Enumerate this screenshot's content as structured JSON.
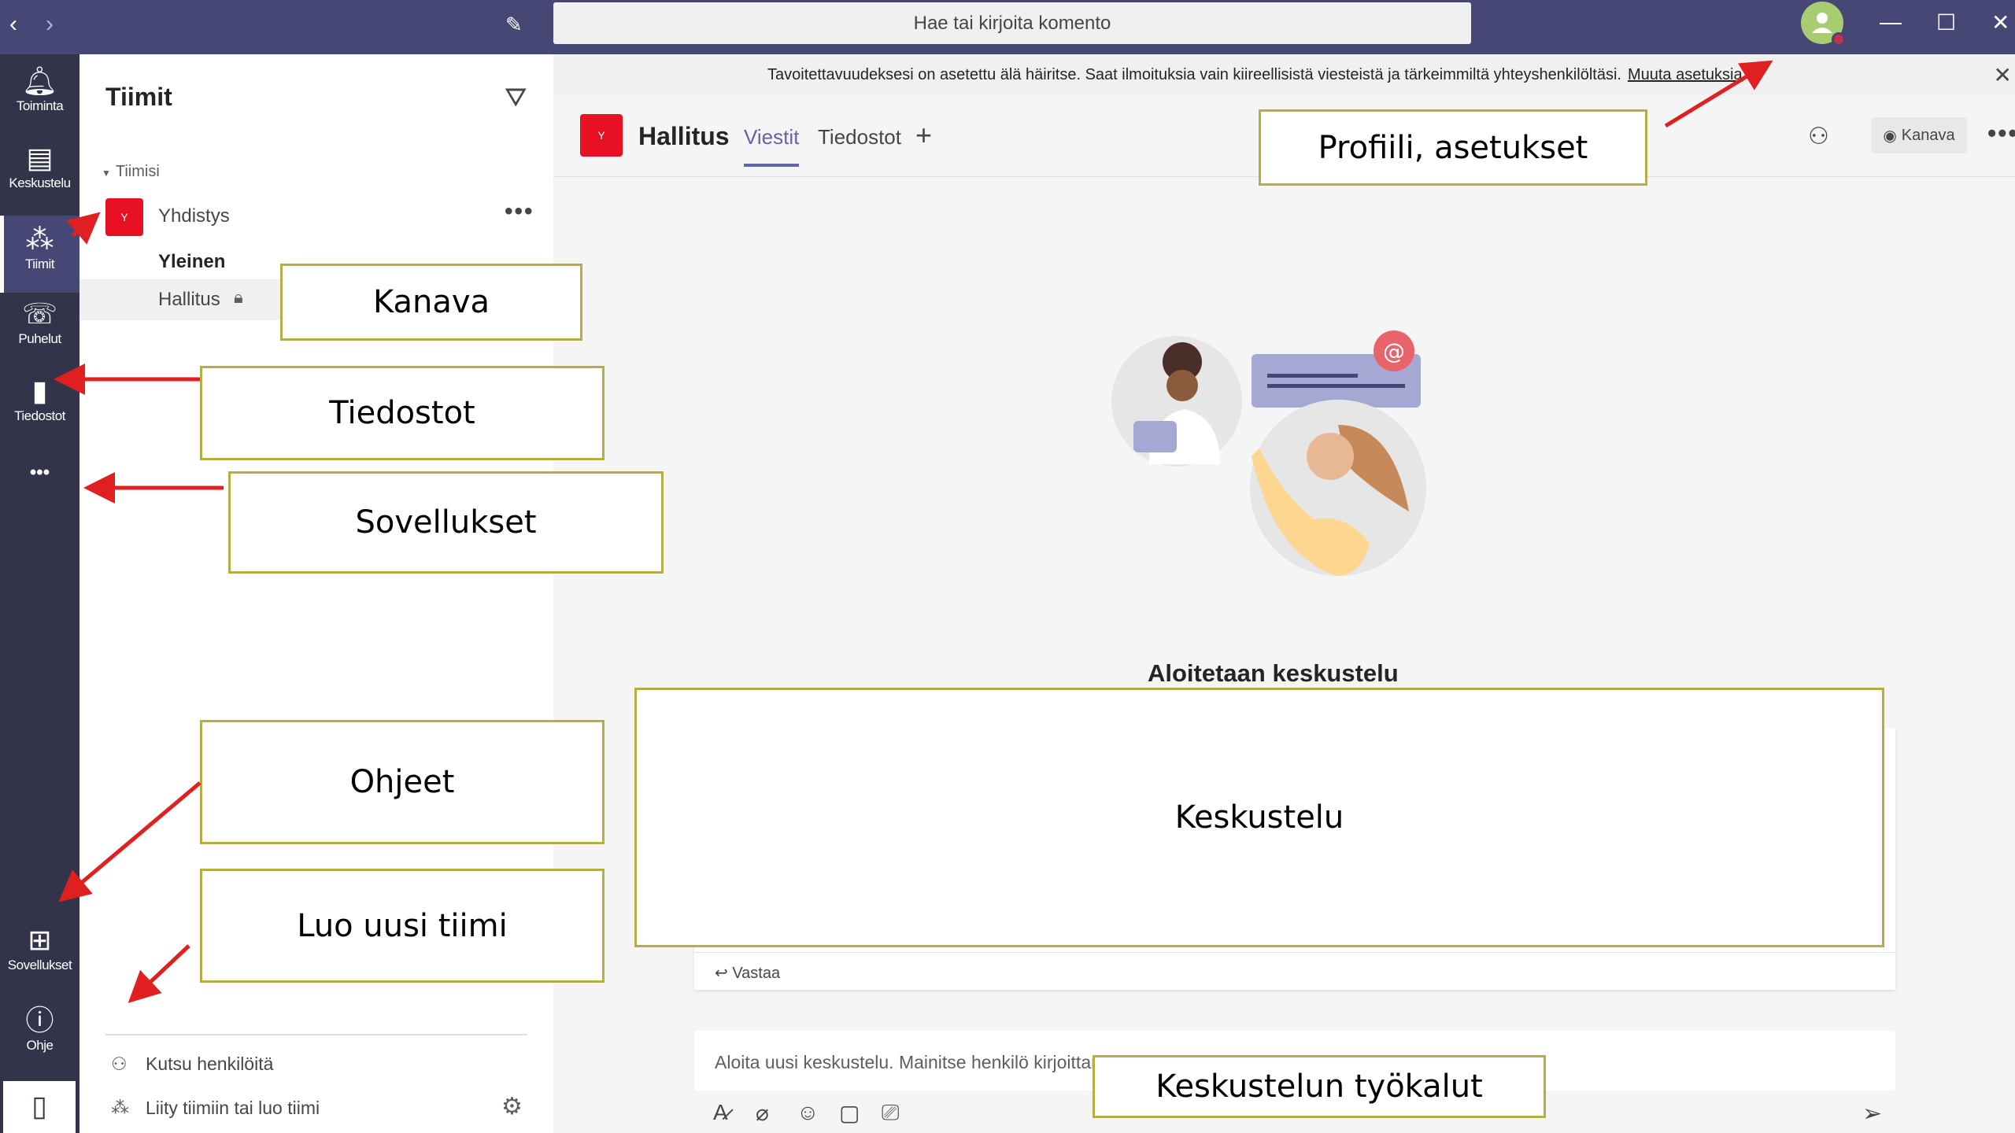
{
  "window": {
    "search_placeholder": "Hae tai kirjoita komento",
    "minimize_glyph": "—",
    "maximize_glyph": "☐",
    "close_glyph": "✕"
  },
  "rail": {
    "items": [
      {
        "label": "Toiminta",
        "icon": "bell-icon"
      },
      {
        "label": "Keskustelu",
        "icon": "chat-icon"
      },
      {
        "label": "Tiimit",
        "icon": "teams-icon"
      },
      {
        "label": "Puhelut",
        "icon": "phone-icon"
      },
      {
        "label": "Tiedostot",
        "icon": "file-icon"
      },
      {
        "label": "Sovellukset",
        "icon": "apps-icon"
      },
      {
        "label": "Ohje",
        "icon": "help-icon"
      }
    ],
    "more_glyph": "•••"
  },
  "teams_pane": {
    "title": "Tiimit",
    "section_label": "Tiimisi",
    "team": {
      "badge": "Y",
      "name": "Yhdistys"
    },
    "channels": [
      {
        "name": "Yleinen"
      },
      {
        "name": "Hallitus"
      }
    ],
    "invite_label": "Kutsu henkilöitä",
    "join_label": "Liity tiimiin tai luo tiimi"
  },
  "banner": {
    "text": "Tavoitettavuudeksesi on asetettu älä häiritse. Saat ilmoituksia vain kiireellisistä viesteistä ja tärkeimmiltä yhteyshenkilöltäsi.",
    "link": "Muuta asetuksia"
  },
  "channel": {
    "badge": "Y",
    "name": "Hallitus",
    "tabs": [
      {
        "label": "Viestit",
        "active": true
      },
      {
        "label": "Tiedostot",
        "active": false
      }
    ],
    "view_button": "Kanava"
  },
  "conversation": {
    "empty_title": "Aloitetaan keskustelu",
    "reply_label": "Vastaa",
    "compose_placeholder": "Aloita uusi keskustelu. Mainitse henkilö kirjoittamalla @."
  },
  "callouts": {
    "kanava": "Kanava",
    "tiedostot": "Tiedostot",
    "sovellukset": "Sovellukset",
    "ohjeet": "Ohjeet",
    "luo_uusi_tiimi": "Luo uusi tiimi",
    "profiili": "Profiili, asetukset",
    "keskustelu": "Keskustelu",
    "tyokalut": "Keskustelun työkalut"
  },
  "colors": {
    "topbar": "#464775",
    "rail": "#33344a",
    "accent": "#6264a7",
    "team_badge": "#e81123",
    "callout_border": "#b5ae45",
    "arrow": "#e02020"
  }
}
